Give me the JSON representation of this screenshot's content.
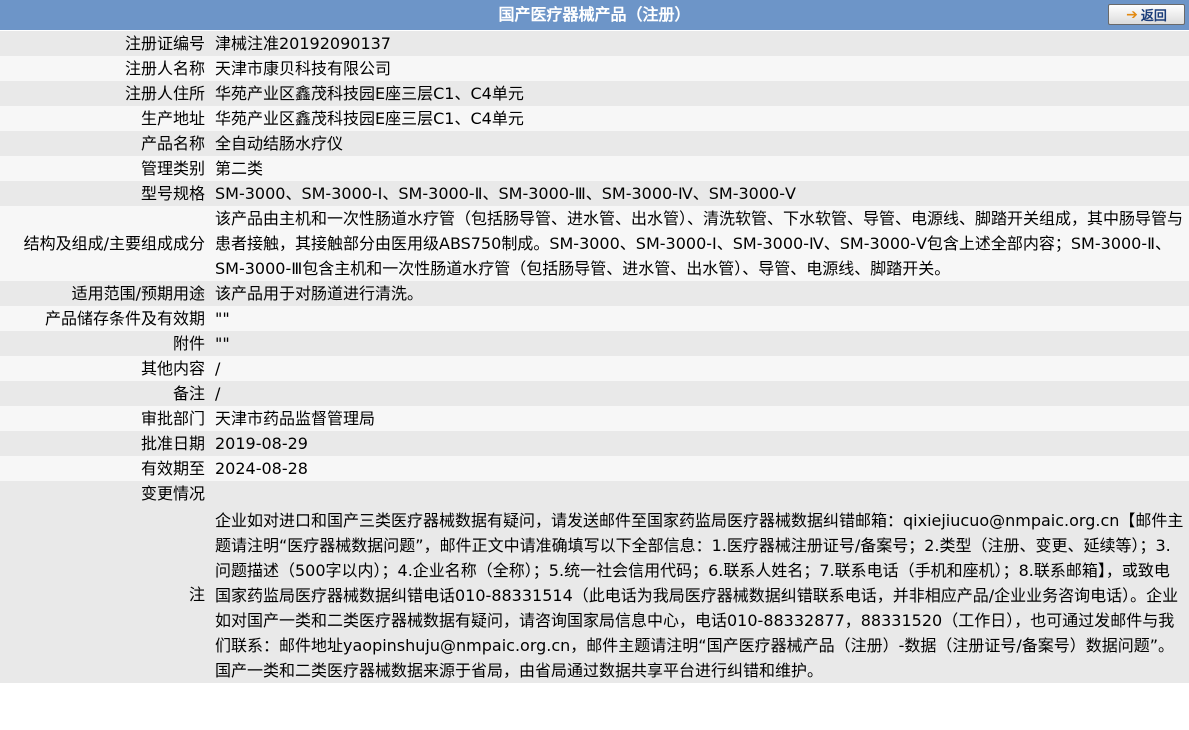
{
  "header": {
    "title": "国产医疗器械产品（注册）",
    "back_label": "返回"
  },
  "rows": {
    "reg_no": {
      "label": "注册证编号",
      "value": "津械注准20192090137"
    },
    "registrant": {
      "label": "注册人名称",
      "value": "天津市康贝科技有限公司"
    },
    "registrant_address": {
      "label": "注册人住所",
      "value": "华苑产业区鑫茂科技园E座三层C1、C4单元"
    },
    "production_address": {
      "label": "生产地址",
      "value": "华苑产业区鑫茂科技园E座三层C1、C4单元"
    },
    "product_name": {
      "label": "产品名称",
      "value": "全自动结肠水疗仪"
    },
    "category": {
      "label": "管理类别",
      "value": "第二类"
    },
    "model": {
      "label": "型号规格",
      "value": "SM-3000、SM-3000-Ⅰ、SM-3000-Ⅱ、SM-3000-Ⅲ、SM-3000-Ⅳ、SM-3000-Ⅴ"
    },
    "structure": {
      "label": "结构及组成/主要组成成分",
      "value": "该产品由主机和一次性肠道水疗管（包括肠导管、进水管、出水管）、清洗软管、下水软管、导管、电源线、脚踏开关组成，其中肠导管与患者接触，其接触部分由医用级ABS750制成。SM-3000、SM-3000-Ⅰ、SM-3000-Ⅳ、SM-3000-Ⅴ包含上述全部内容；SM-3000-Ⅱ、SM-3000-Ⅲ包含主机和一次性肠道水疗管（包括肠导管、进水管、出水管）、导管、电源线、脚踏开关。"
    },
    "scope": {
      "label": "适用范围/预期用途",
      "value": "该产品用于对肠道进行清洗。"
    },
    "storage": {
      "label": "产品储存条件及有效期",
      "value": "\"\""
    },
    "attachment": {
      "label": "附件",
      "value": "\"\""
    },
    "other": {
      "label": "其他内容",
      "value": "/"
    },
    "remark": {
      "label": "备注",
      "value": "/"
    },
    "approval_dept": {
      "label": "审批部门",
      "value": "天津市药品监督管理局"
    },
    "approval_date": {
      "label": "批准日期",
      "value": "2019-08-29"
    },
    "expiry": {
      "label": "有效期至",
      "value": "2024-08-28"
    },
    "change": {
      "label": "变更情况",
      "value": ""
    },
    "note": {
      "label": "注",
      "value": "企业如对进口和国产三类医疗器械数据有疑问，请发送邮件至国家药监局医疗器械数据纠错邮箱：qixiejiucuo@nmpaic.org.cn【邮件主题请注明“医疗器械数据问题”，邮件正文中请准确填写以下全部信息：1.医疗器械注册证号/备案号；2.类型（注册、变更、延续等）；3.问题描述（500字以内）；4.企业名称（全称）；5.统一社会信用代码；6.联系人姓名；7.联系电话（手机和座机）；8.联系邮箱】，或致电国家药监局医疗器械数据纠错电话010-88331514（此电话为我局医疗器械数据纠错联系电话，并非相应产品/企业业务咨询电话）。企业如对国产一类和二类医疗器械数据有疑问，请咨询国家局信息中心，电话010-88332877，88331520（工作日），也可通过发邮件与我们联系：邮件地址yaopinshuju@nmpaic.org.cn，邮件主题请注明“国产医疗器械产品（注册）-数据（注册证号/备案号）数据问题”。国产一类和二类医疗器械数据来源于省局，由省局通过数据共享平台进行纠错和维护。"
    }
  },
  "colors": {
    "header_bg": "#6d95c8",
    "row_odd": "#e9e9e9",
    "row_even": "#f7f7f7"
  },
  "icons": {
    "back": "arrow-right-icon"
  }
}
